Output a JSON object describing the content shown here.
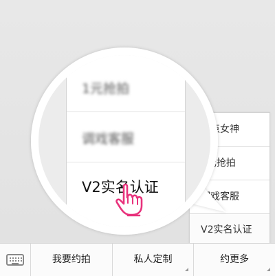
{
  "popup_menu": {
    "items": [
      {
        "label": "三点女神"
      },
      {
        "label": "1元抢拍"
      },
      {
        "label": "调戏客服"
      },
      {
        "label": "V2实名认证"
      }
    ]
  },
  "magnifier": {
    "items": [
      {
        "label": "1元抢拍"
      },
      {
        "label": "调戏客服"
      },
      {
        "label": "V2实名认证"
      }
    ],
    "hand_icon": "pointing-hand-icon",
    "hand_color": "#e8327c"
  },
  "bottom_bar": {
    "keyboard_icon": "keyboard-icon",
    "menus": [
      {
        "label": "我要约拍",
        "has_submenu": false
      },
      {
        "label": "私人定制",
        "has_submenu": true
      },
      {
        "label": "约更多",
        "has_submenu": true
      }
    ]
  },
  "colors": {
    "background": "#e4e4e4",
    "menu_bg": "#ffffff",
    "border": "#d5d5d5",
    "accent_hand": "#e8327c"
  }
}
